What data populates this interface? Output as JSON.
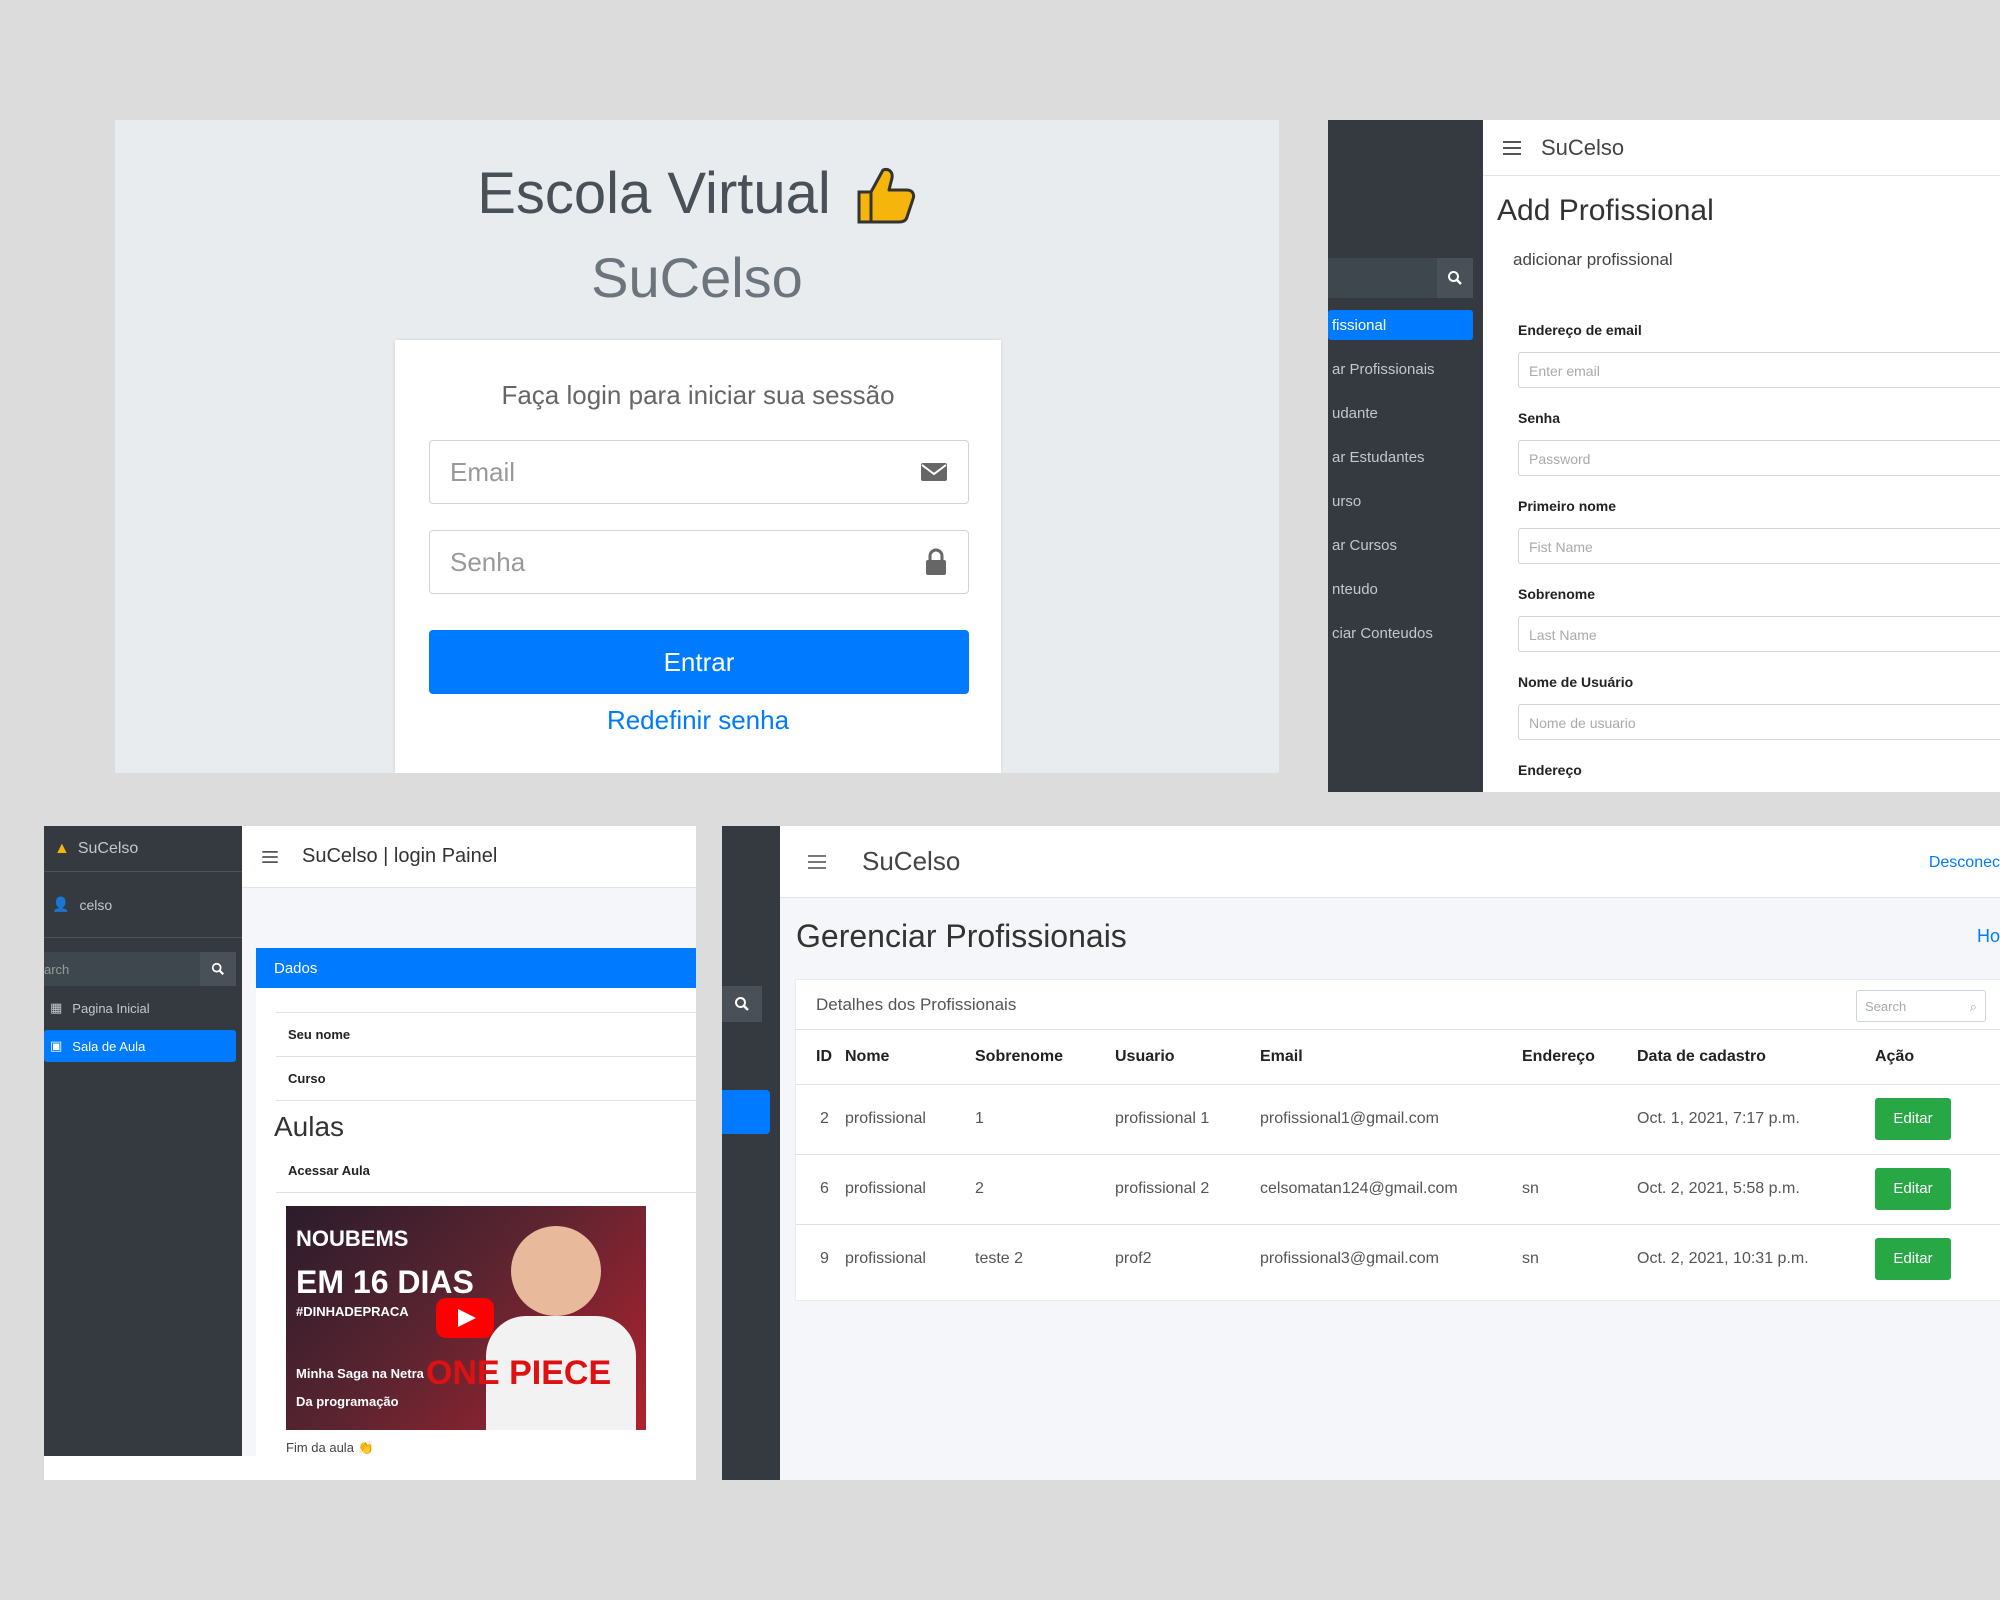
{
  "login": {
    "title": "Escola Virtual",
    "brand": "SuCelso",
    "message": "Faça login para iniciar sua sessão",
    "email_placeholder": "Email",
    "password_placeholder": "Senha",
    "submit_label": "Entrar",
    "reset_link": "Redefinir senha",
    "colors": {
      "primary": "#007bff",
      "thumb": "#f5b50a"
    }
  },
  "add_profissional": {
    "app_title": "SuCelso",
    "page_title": "Add Profissional",
    "card_title": "adicionar profissional",
    "sidebar_items": [
      {
        "label": "fissional",
        "active": true
      },
      {
        "label": "ar Profissionais",
        "active": false
      },
      {
        "label": "udante",
        "active": false
      },
      {
        "label": "ar Estudantes",
        "active": false
      },
      {
        "label": "urso",
        "active": false
      },
      {
        "label": "ar Cursos",
        "active": false
      },
      {
        "label": "nteudo",
        "active": false
      },
      {
        "label": "ciar Conteudos",
        "active": false
      }
    ],
    "fields": [
      {
        "label": "Endereço de email",
        "placeholder": "Enter email"
      },
      {
        "label": "Senha",
        "placeholder": "Password"
      },
      {
        "label": "Primeiro nome",
        "placeholder": "Fist Name"
      },
      {
        "label": "Sobrenome",
        "placeholder": "Last Name"
      },
      {
        "label": "Nome de Usuário",
        "placeholder": "Nome de usuario"
      }
    ],
    "next_label": "Endereço"
  },
  "aulas": {
    "app_title": "SuCelso | login Painel",
    "sidebar_brand": "SuCelso",
    "sidebar_user": "celso",
    "search_placeholder": "arch",
    "nav": [
      {
        "label": "Pagina Inicial",
        "active": false
      },
      {
        "label": "Sala de Aula",
        "active": true
      }
    ],
    "card_header": "Dados",
    "rows": [
      "Seu nome",
      "Curso"
    ],
    "section_title": "Aulas",
    "access_label": "Acessar Aula",
    "video_title_line1": "NOUBEMS",
    "video_title_line2": "EM 16 DIAS",
    "video_line3": "#DINHADEPRACA",
    "video_line4": "Minha Saga na Netra",
    "video_line5": "Da programação",
    "video_shirt": "ONE PIECE",
    "caption": "Fim da aula"
  },
  "gerenciar": {
    "app_title": "SuCelso",
    "logout": "Desconec",
    "page_title": "Gerenciar Profissionais",
    "home_link": "Ho",
    "card_title": "Detalhes dos Profissionais",
    "search_placeholder": "Search",
    "columns": [
      "ID",
      "Nome",
      "Sobrenome",
      "Usuario",
      "Email",
      "Endereço",
      "Data de cadastro",
      "Ação"
    ],
    "rows": [
      {
        "id": "2",
        "nome": "profissional",
        "sobrenome": "1",
        "usuario": "profissional 1",
        "email": "profissional1@gmail.com",
        "endereco": "",
        "data": "Oct. 1, 2021, 7:17 p.m.",
        "acao": "Editar"
      },
      {
        "id": "6",
        "nome": "profissional",
        "sobrenome": "2",
        "usuario": "profissional 2",
        "email": "celsomatan124@gmail.com",
        "endereco": "sn",
        "data": "Oct. 2, 2021, 5:58 p.m.",
        "acao": "Editar"
      },
      {
        "id": "9",
        "nome": "profissional",
        "sobrenome": "teste 2",
        "usuario": "prof2",
        "email": "profissional3@gmail.com",
        "endereco": "sn",
        "data": "Oct. 2, 2021, 10:31 p.m.",
        "acao": "Editar"
      }
    ],
    "colors": {
      "edit": "#28a745"
    }
  }
}
